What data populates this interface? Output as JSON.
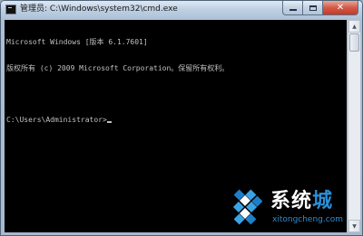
{
  "window": {
    "title": "管理员: C:\\Windows\\system32\\cmd.exe",
    "minimize_glyph": "",
    "maximize_glyph": "",
    "close_glyph": "✕"
  },
  "console": {
    "lines": [
      "Microsoft Windows [版本 6.1.7601]",
      "版权所有 (c) 2009 Microsoft Corporation。保留所有权利。",
      "",
      "C:\\Users\\Administrator>"
    ],
    "text_color": "#c0c0c0",
    "background_color": "#000000"
  },
  "scrollbar": {
    "up_arrow": "▲",
    "down_arrow": "▼"
  },
  "watermark": {
    "brand_main": "系统",
    "brand_accent": "城",
    "url": "xitongcheng.com",
    "accent_color": "#2b8fd6"
  }
}
